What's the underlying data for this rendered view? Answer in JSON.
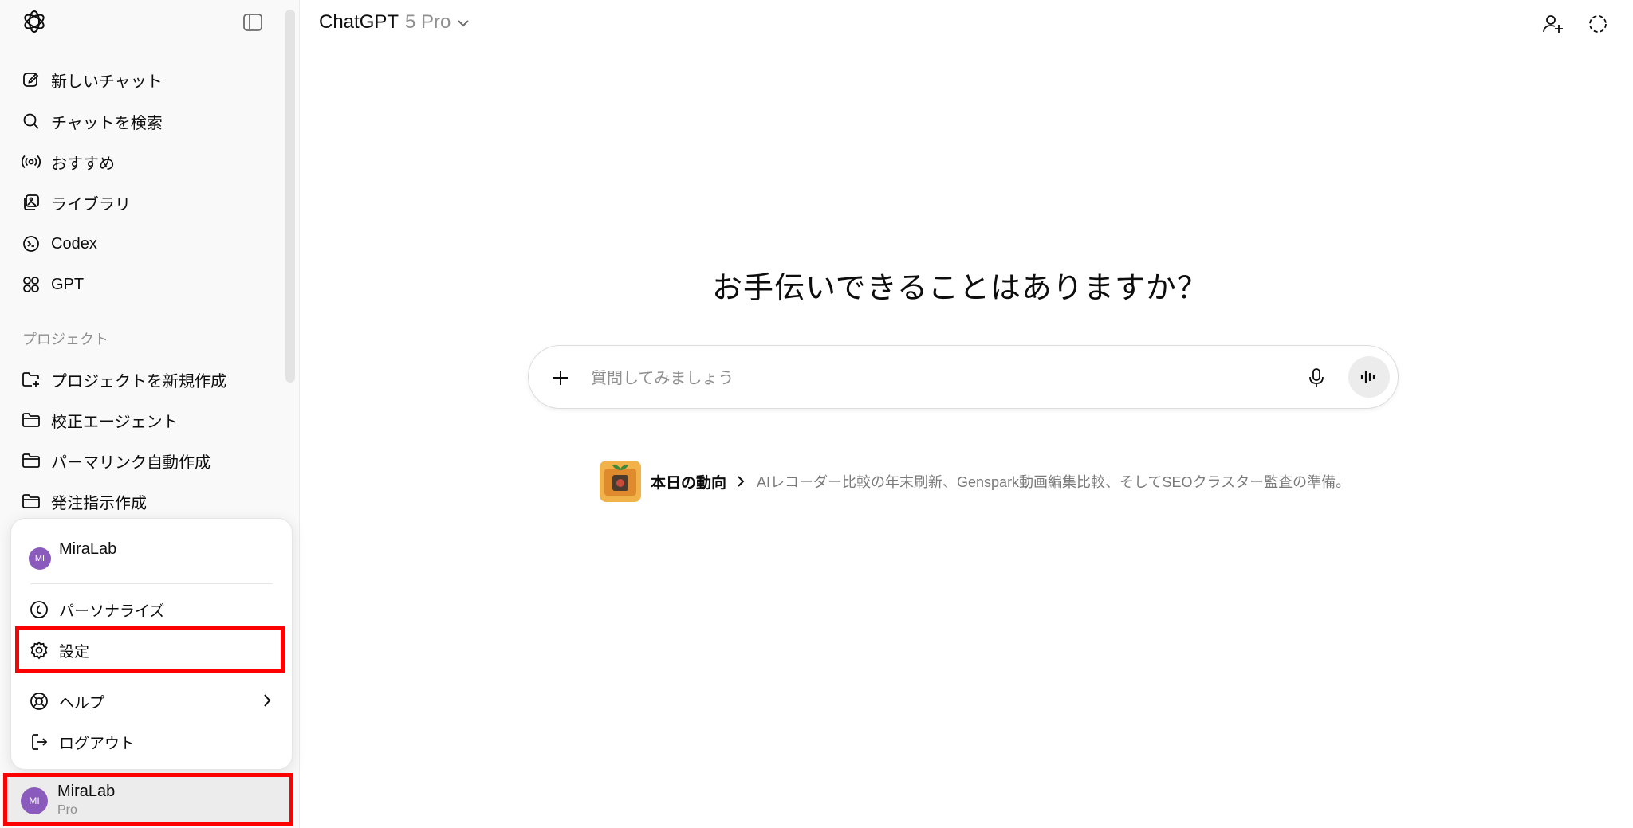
{
  "sidebar": {
    "nav": [
      {
        "label": "新しいチャット",
        "icon": "new-chat-icon"
      },
      {
        "label": "チャットを検索",
        "icon": "search-icon"
      },
      {
        "label": "おすすめ",
        "icon": "broadcast-icon"
      },
      {
        "label": "ライブラリ",
        "icon": "library-icon"
      },
      {
        "label": "Codex",
        "icon": "codex-icon"
      },
      {
        "label": "GPT",
        "icon": "grid-icon"
      }
    ],
    "projects_label": "プロジェクト",
    "projects": [
      {
        "label": "プロジェクトを新規作成",
        "icon": "folder-plus-icon"
      },
      {
        "label": "校正エージェント",
        "icon": "folder-icon"
      },
      {
        "label": "パーマリンク自動作成",
        "icon": "folder-icon"
      },
      {
        "label": "発注指示作成",
        "icon": "folder-icon"
      }
    ]
  },
  "account_menu": {
    "user_name": "MiraLab",
    "avatar_initials": "MI",
    "items": [
      {
        "label": "パーソナライズ",
        "icon": "personalize-icon"
      },
      {
        "label": "設定",
        "icon": "gear-icon"
      },
      {
        "label": "ヘルプ",
        "icon": "help-icon"
      },
      {
        "label": "ログアウト",
        "icon": "logout-icon"
      }
    ]
  },
  "bottom_user": {
    "name": "MiraLab",
    "plan": "Pro",
    "avatar_initials": "MI"
  },
  "header": {
    "app_name": "ChatGPT",
    "model_version": "5 Pro"
  },
  "main": {
    "headline": "お手伝いできることはありますか？",
    "composer_placeholder": "質問してみましょう",
    "trend_title": "本日の動向",
    "trend_text": "AIレコーダー比較の年末刷新、Genspark動画編集比較、そしてSEOクラスター監査の準備。"
  },
  "colors": {
    "highlight": "#ff0000",
    "avatar": "#8a5bbd",
    "sidebar_bg": "#f9f9f9"
  }
}
